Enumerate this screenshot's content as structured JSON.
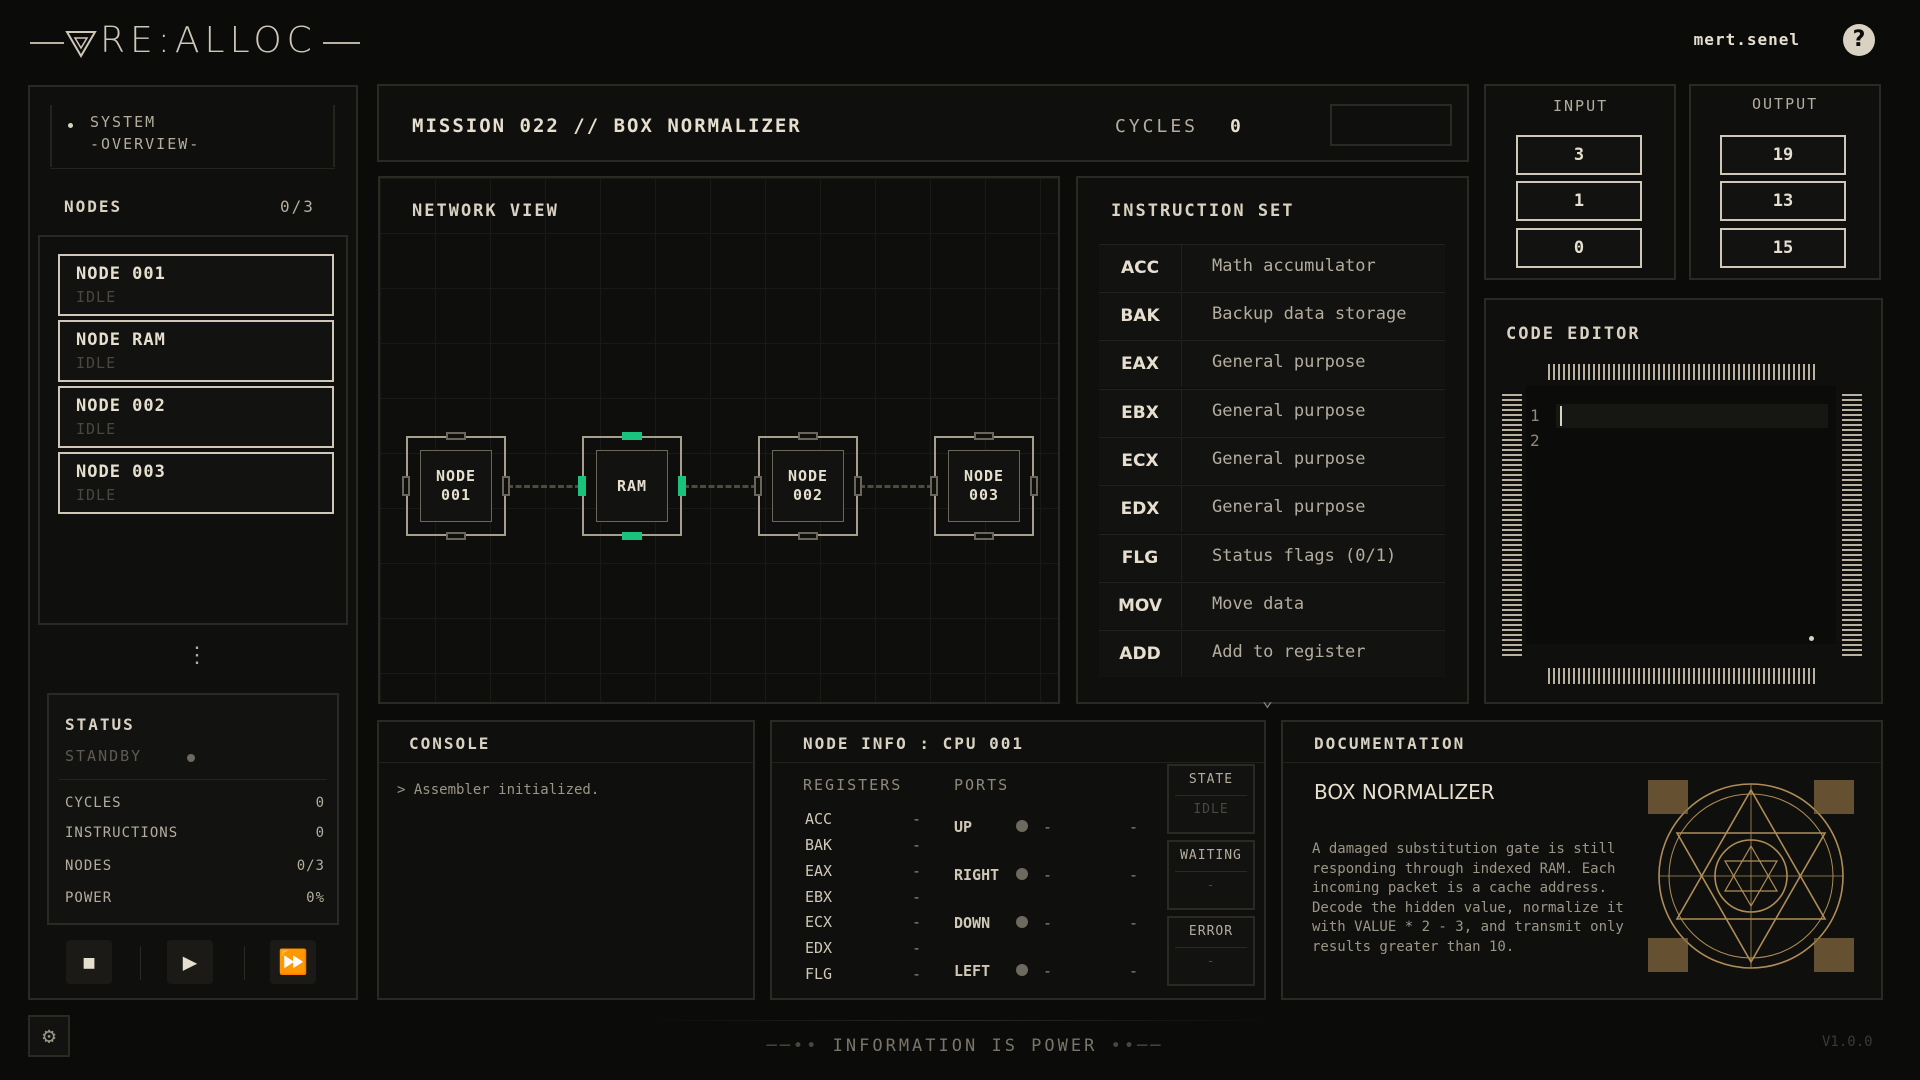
{
  "app": {
    "logo": "RE:ALLOC",
    "user": "mert.senel",
    "help": "?"
  },
  "sidebar": {
    "system_label": "SYSTEM",
    "system_sub": "-OVERVIEW-",
    "nodes_label": "NODES",
    "nodes_count": "0/3",
    "nodes": [
      {
        "name": "NODE 001",
        "state": "IDLE"
      },
      {
        "name": "NODE RAM",
        "state": "IDLE"
      },
      {
        "name": "NODE 002",
        "state": "IDLE"
      },
      {
        "name": "NODE 003",
        "state": "IDLE"
      }
    ],
    "more": "⋮",
    "status": {
      "title": "STATUS",
      "state": "STANDBY",
      "rows": [
        {
          "label": "CYCLES",
          "value": "0"
        },
        {
          "label": "INSTRUCTIONS",
          "value": "0"
        },
        {
          "label": "NODES",
          "value": "0/3"
        },
        {
          "label": "POWER",
          "value": "0%"
        }
      ]
    },
    "controls": {
      "stop": "■",
      "play": "▶",
      "fast": "⏩"
    },
    "settings_icon": "⚙"
  },
  "mission": {
    "title": "MISSION 022 // BOX NORMALIZER",
    "cycles_label": "CYCLES",
    "cycles_value": "0"
  },
  "network": {
    "title": "NETWORK VIEW",
    "nodes": [
      {
        "label": "NODE\n001"
      },
      {
        "label": "RAM"
      },
      {
        "label": "NODE\n002"
      },
      {
        "label": "NODE\n003"
      }
    ]
  },
  "instructions": {
    "title": "INSTRUCTION SET",
    "items": [
      {
        "op": "ACC",
        "desc": "Math accumulator"
      },
      {
        "op": "BAK",
        "desc": "Backup data storage"
      },
      {
        "op": "EAX",
        "desc": "General purpose"
      },
      {
        "op": "EBX",
        "desc": "General purpose"
      },
      {
        "op": "ECX",
        "desc": "General purpose"
      },
      {
        "op": "EDX",
        "desc": "General purpose"
      },
      {
        "op": "FLG",
        "desc": "Status flags (0/1)"
      },
      {
        "op": "MOV",
        "desc": "Move data"
      },
      {
        "op": "ADD",
        "desc": "Add to register"
      }
    ],
    "chevron": "⌄"
  },
  "io": {
    "input_label": "INPUT",
    "output_label": "OUTPUT",
    "input": [
      "3",
      "1",
      "0"
    ],
    "output": [
      "19",
      "13",
      "15"
    ]
  },
  "code_editor": {
    "title": "CODE EDITOR",
    "line_numbers": [
      "1",
      "2"
    ]
  },
  "console": {
    "title": "CONSOLE",
    "lines": [
      "> Assembler initialized."
    ]
  },
  "node_info": {
    "title": "NODE INFO : CPU 001",
    "registers_label": "REGISTERS",
    "ports_label": "PORTS",
    "registers": [
      {
        "name": "ACC",
        "value": "-"
      },
      {
        "name": "BAK",
        "value": "-"
      },
      {
        "name": "EAX",
        "value": "-"
      },
      {
        "name": "EBX",
        "value": "-"
      },
      {
        "name": "ECX",
        "value": "-"
      },
      {
        "name": "EDX",
        "value": "-"
      },
      {
        "name": "FLG",
        "value": "-"
      }
    ],
    "ports": [
      {
        "name": "UP",
        "v1": "-",
        "v2": "-"
      },
      {
        "name": "RIGHT",
        "v1": "-",
        "v2": "-"
      },
      {
        "name": "DOWN",
        "v1": "-",
        "v2": "-"
      },
      {
        "name": "LEFT",
        "v1": "-",
        "v2": "-"
      }
    ],
    "state_boxes": [
      {
        "label": "STATE",
        "value": "IDLE"
      },
      {
        "label": "WAITING",
        "value": "-"
      },
      {
        "label": "ERROR",
        "value": "-"
      }
    ]
  },
  "documentation": {
    "title": "DOCUMENTATION",
    "heading": "BOX NORMALIZER",
    "body": "A damaged substitution gate is still responding through indexed RAM. Each incoming packet is a cache address. Decode the hidden value, normalize it with VALUE * 2 - 3, and transmit only results greater than 10."
  },
  "footer": {
    "text": "INFORMATION IS POWER",
    "version": "V1.0.0"
  },
  "colors": {
    "accent_green": "#19c27d",
    "border": "#2b2923",
    "text": "#d9d2c2",
    "background": "#0b0b0a"
  }
}
